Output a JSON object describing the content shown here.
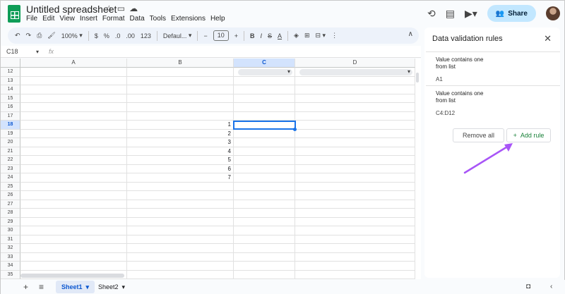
{
  "doc": {
    "title": "Untitled spreadsheet"
  },
  "menu": [
    "File",
    "Edit",
    "View",
    "Insert",
    "Format",
    "Data",
    "Tools",
    "Extensions",
    "Help"
  ],
  "header": {
    "share_label": "Share"
  },
  "toolbar": {
    "zoom": "100%",
    "currency": "$",
    "percent": "%",
    "decimal_less": ".0",
    "decimal_more": ".00",
    "format_more": "123",
    "font": "Defaul...",
    "font_size": "10",
    "minus": "−",
    "plus": "+",
    "bold": "B",
    "italic": "I"
  },
  "formula_bar": {
    "cell_ref": "C18",
    "fx": "fx"
  },
  "grid": {
    "columns": [
      "A",
      "B",
      "C",
      "D"
    ],
    "selected_column": "C",
    "first_row": 12,
    "selected_row": 18,
    "rows": [
      12,
      13,
      14,
      15,
      16,
      17,
      18,
      19,
      20,
      21,
      22,
      23,
      24,
      25,
      26,
      27,
      28,
      29,
      30,
      31,
      32,
      33,
      34,
      35
    ],
    "b_values": {
      "18": "1",
      "19": "2",
      "20": "3",
      "21": "4",
      "22": "5",
      "23": "6",
      "24": "7"
    }
  },
  "sheets": {
    "tab1": "Sheet1",
    "tab2": "Sheet2"
  },
  "panel": {
    "title": "Data validation rules",
    "rules": [
      {
        "line1": "Value contains one",
        "line2": "from list",
        "range": "A1"
      },
      {
        "line1": "Value contains one",
        "line2": "from list",
        "range": "C4:D12"
      }
    ],
    "remove_all": "Remove all",
    "add_rule": "Add rule"
  },
  "colors": {
    "accent": "#1a73e8",
    "arrow": "#a855f7",
    "add_green": "#188038",
    "share_bg": "#c2e7ff"
  }
}
